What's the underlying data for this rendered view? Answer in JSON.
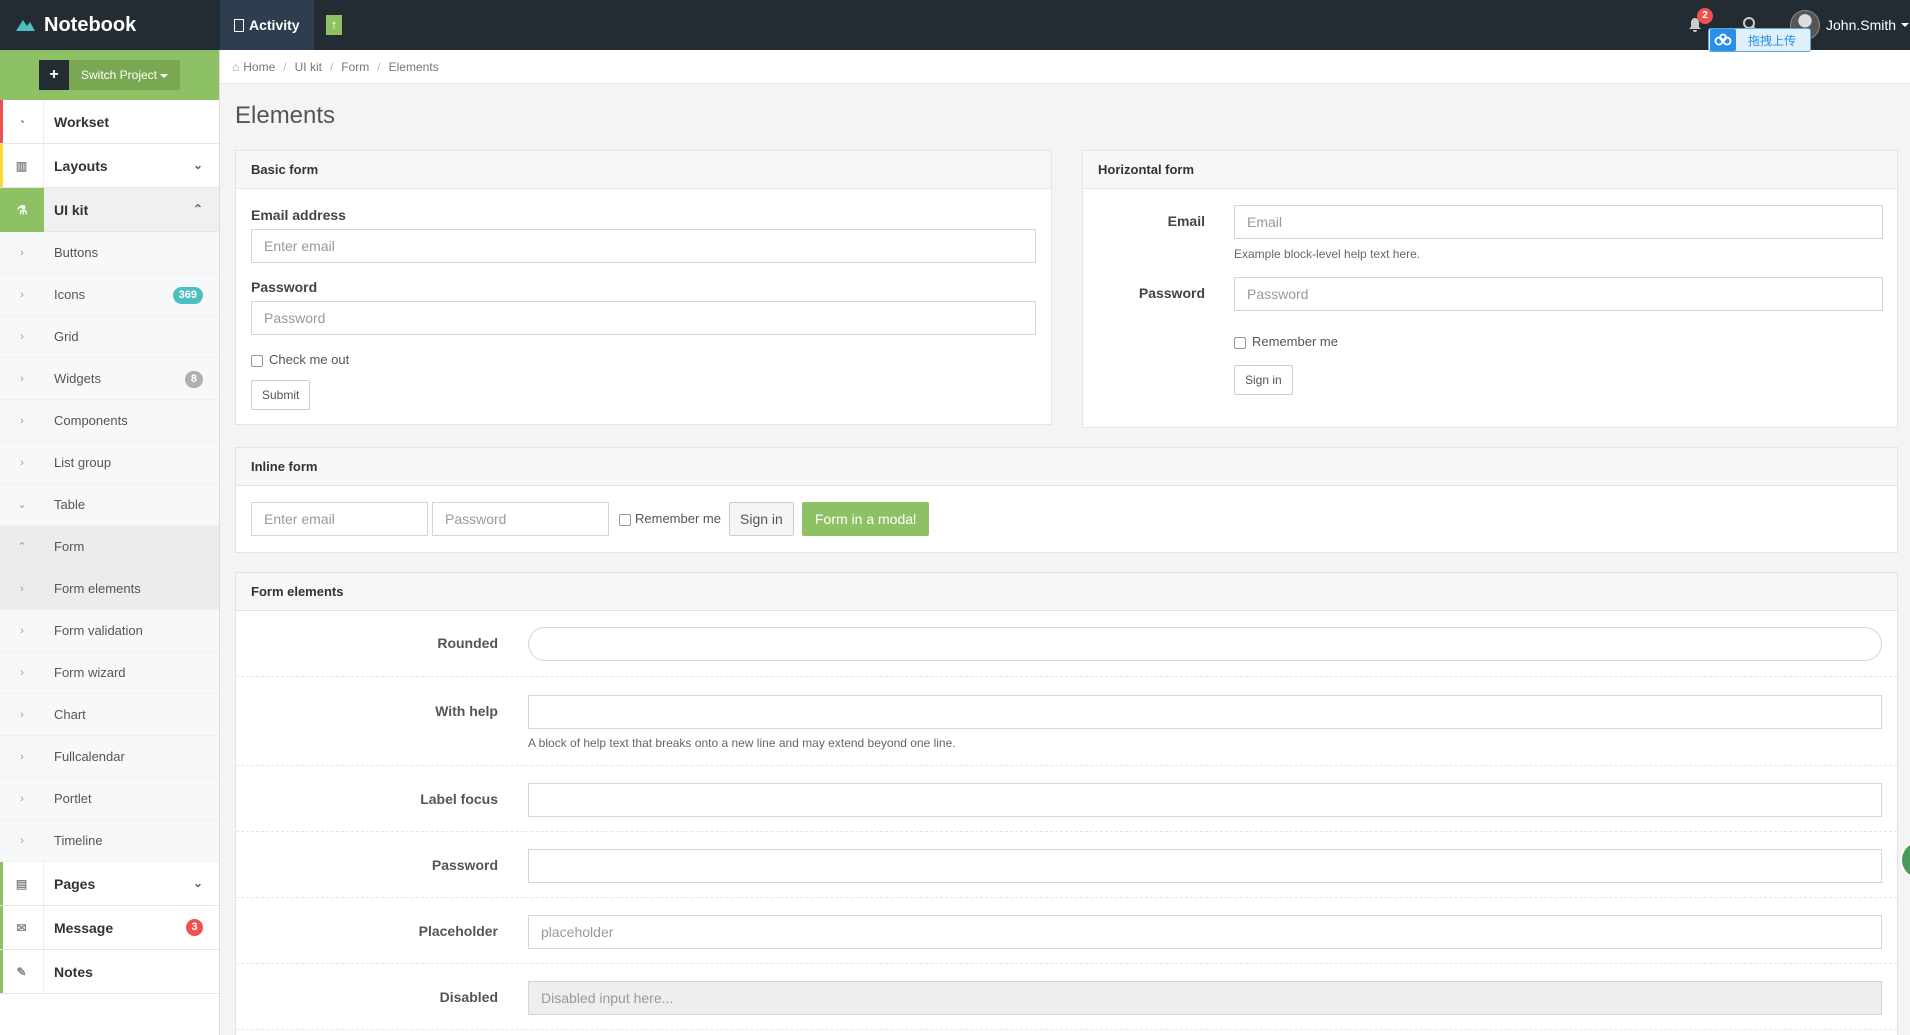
{
  "topbar": {
    "brand": "Notebook",
    "activity": "Activity",
    "notif_count": "2",
    "user": "John.Smith",
    "cloud_label": "拖拽上传"
  },
  "sidebar": {
    "switch_label": "Switch Project",
    "workset": "Workset",
    "layouts": "Layouts",
    "uikit": "UI kit",
    "sub": {
      "buttons": "Buttons",
      "icons": "Icons",
      "icons_badge": "369",
      "grid": "Grid",
      "widgets": "Widgets",
      "widgets_badge": "8",
      "components": "Components",
      "listgroup": "List group",
      "table": "Table",
      "form": "Form",
      "formelements": "Form elements",
      "formvalidation": "Form validation",
      "formwizard": "Form wizard",
      "chart": "Chart",
      "fullcalendar": "Fullcalendar",
      "portlet": "Portlet",
      "timeline": "Timeline"
    },
    "pages": "Pages",
    "message": "Message",
    "message_badge": "3",
    "notes": "Notes"
  },
  "breadcrumb": [
    "Home",
    "UI kit",
    "Form",
    "Elements"
  ],
  "page_title": "Elements",
  "basic_form": {
    "title": "Basic form",
    "email_label": "Email address",
    "email_ph": "Enter email",
    "password_label": "Password",
    "password_ph": "Password",
    "check_label": "Check me out",
    "submit": "Submit"
  },
  "horizontal_form": {
    "title": "Horizontal form",
    "email_label": "Email",
    "email_ph": "Email",
    "help": "Example block-level help text here.",
    "password_label": "Password",
    "password_ph": "Password",
    "remember": "Remember me",
    "signin": "Sign in"
  },
  "inline_form": {
    "title": "Inline form",
    "email_ph": "Enter email",
    "password_ph": "Password",
    "remember": "Remember me",
    "signin": "Sign in",
    "modal": "Form in a modal"
  },
  "form_elements": {
    "title": "Form elements",
    "rounded": "Rounded",
    "with_help": "With help",
    "help_text": "A block of help text that breaks onto a new line and may extend beyond one line.",
    "label_focus": "Label focus",
    "password": "Password",
    "placeholder_label": "Placeholder",
    "placeholder_ph": "placeholder",
    "disabled_label": "Disabled",
    "disabled_ph": "Disabled input here..."
  },
  "colors": {
    "topbar": "#232c32",
    "accent_green": "#8ec165",
    "badge_teal": "#4cc0c1",
    "badge_red": "#f05050"
  }
}
